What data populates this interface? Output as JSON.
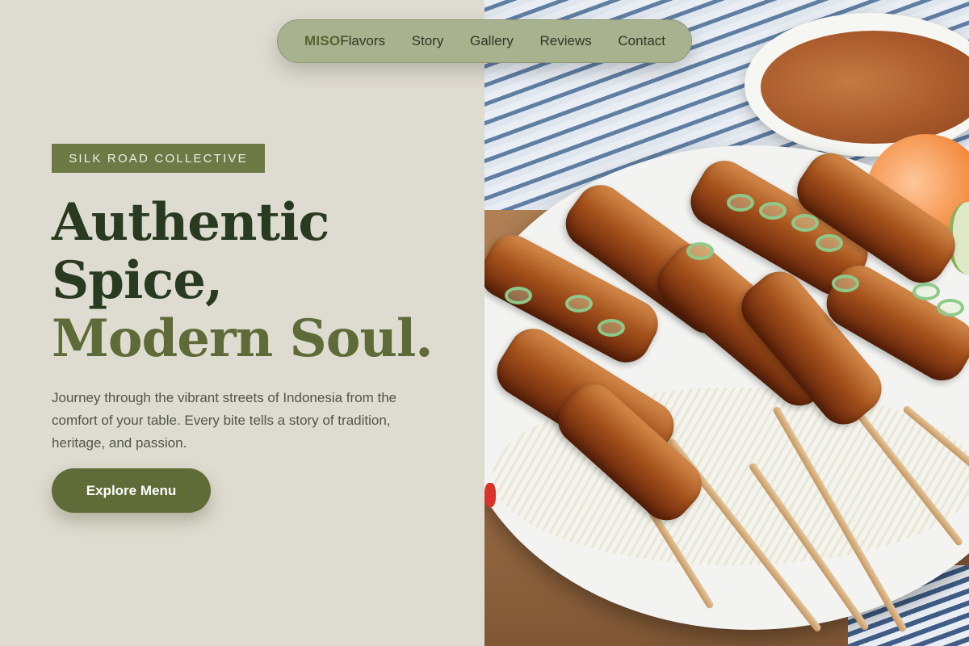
{
  "nav": {
    "brand_strong": "MISO",
    "brand_rest": "Flavors",
    "links": [
      "Story",
      "Gallery",
      "Reviews",
      "Contact"
    ]
  },
  "hero": {
    "badge": "SILK ROAD COLLECTIVE",
    "headline_line1": "Authentic",
    "headline_line2": "Spice,",
    "headline_line3": "Modern Soul.",
    "description": "Journey through the vibrant streets of Indonesia from the comfort of your table. Every bite tells a story of tradition, heritage, and passion.",
    "cta_label": "Explore Menu"
  },
  "image": {
    "subject": "satay-skewers-photo"
  },
  "colors": {
    "background_left": "#dedbd0",
    "nav_pill": "#a9b28e",
    "brand_accent": "#556332",
    "badge": "#6d7a45",
    "headline_dark": "#283a1f",
    "headline_accent": "#5e6b38",
    "cta": "#5f6c37"
  }
}
